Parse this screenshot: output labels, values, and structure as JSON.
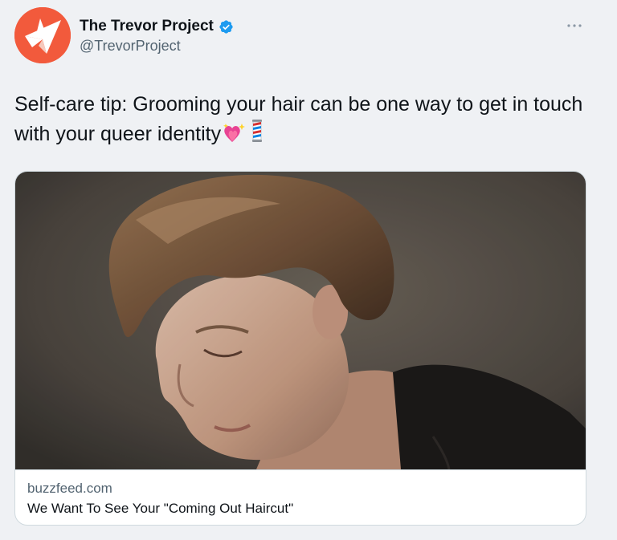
{
  "tweet": {
    "author": {
      "display_name": "The Trevor Project",
      "handle": "@TrevorProject",
      "verified": true,
      "avatar_color": "#f25a3c"
    },
    "more_icon": "more-horizontal-icon",
    "text": "Self-care tip: Grooming your hair can be one way to get in touch with your queer identity",
    "emojis": [
      "sparkling-heart-icon",
      "barber-pole-icon"
    ],
    "card": {
      "domain": "buzzfeed.com",
      "title": "We Want To See Your \"Coming Out Haircut\""
    }
  },
  "colors": {
    "background": "#eff1f4",
    "verified_blue": "#1d9bf0",
    "secondary_text": "#536471",
    "border": "#cfd9de"
  }
}
